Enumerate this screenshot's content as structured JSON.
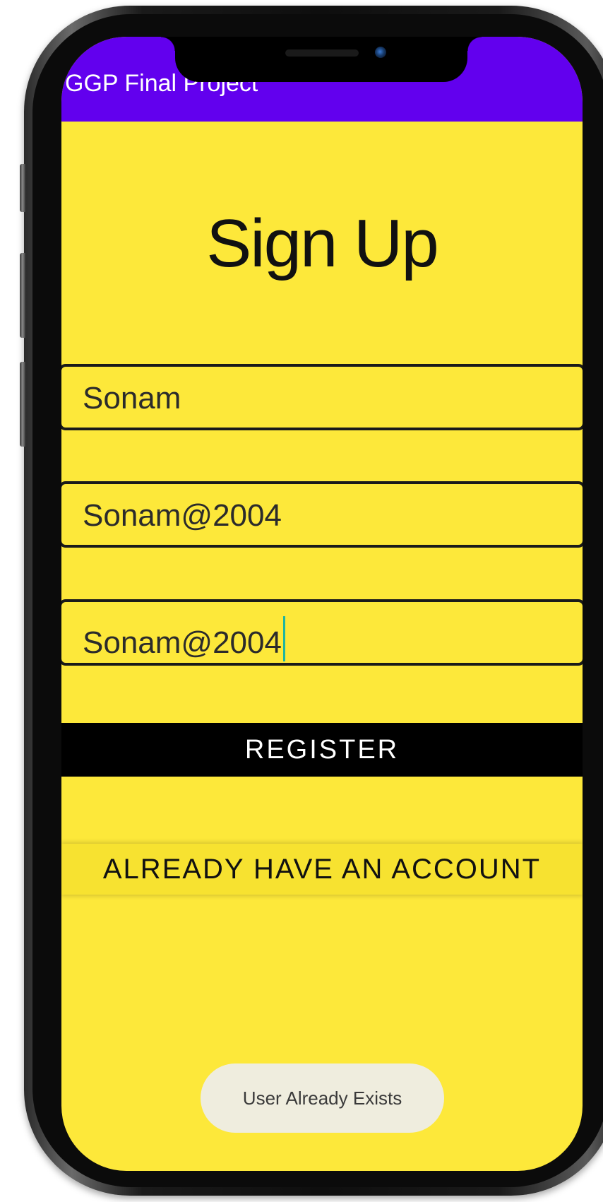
{
  "app_bar": {
    "title": "GGP Final Project"
  },
  "heading": "Sign Up",
  "fields": [
    {
      "value": "Sonam"
    },
    {
      "value": "Sonam@2004"
    },
    {
      "value": "Sonam@2004"
    }
  ],
  "buttons": {
    "register": "REGISTER",
    "already_have_account": "ALREADY HAVE AN ACCOUNT"
  },
  "toast": "User Already Exists",
  "colors": {
    "app_bar": "#6200ee",
    "background": "#fde83a",
    "register_button": "#000000",
    "cursor": "#1fb5a0"
  }
}
